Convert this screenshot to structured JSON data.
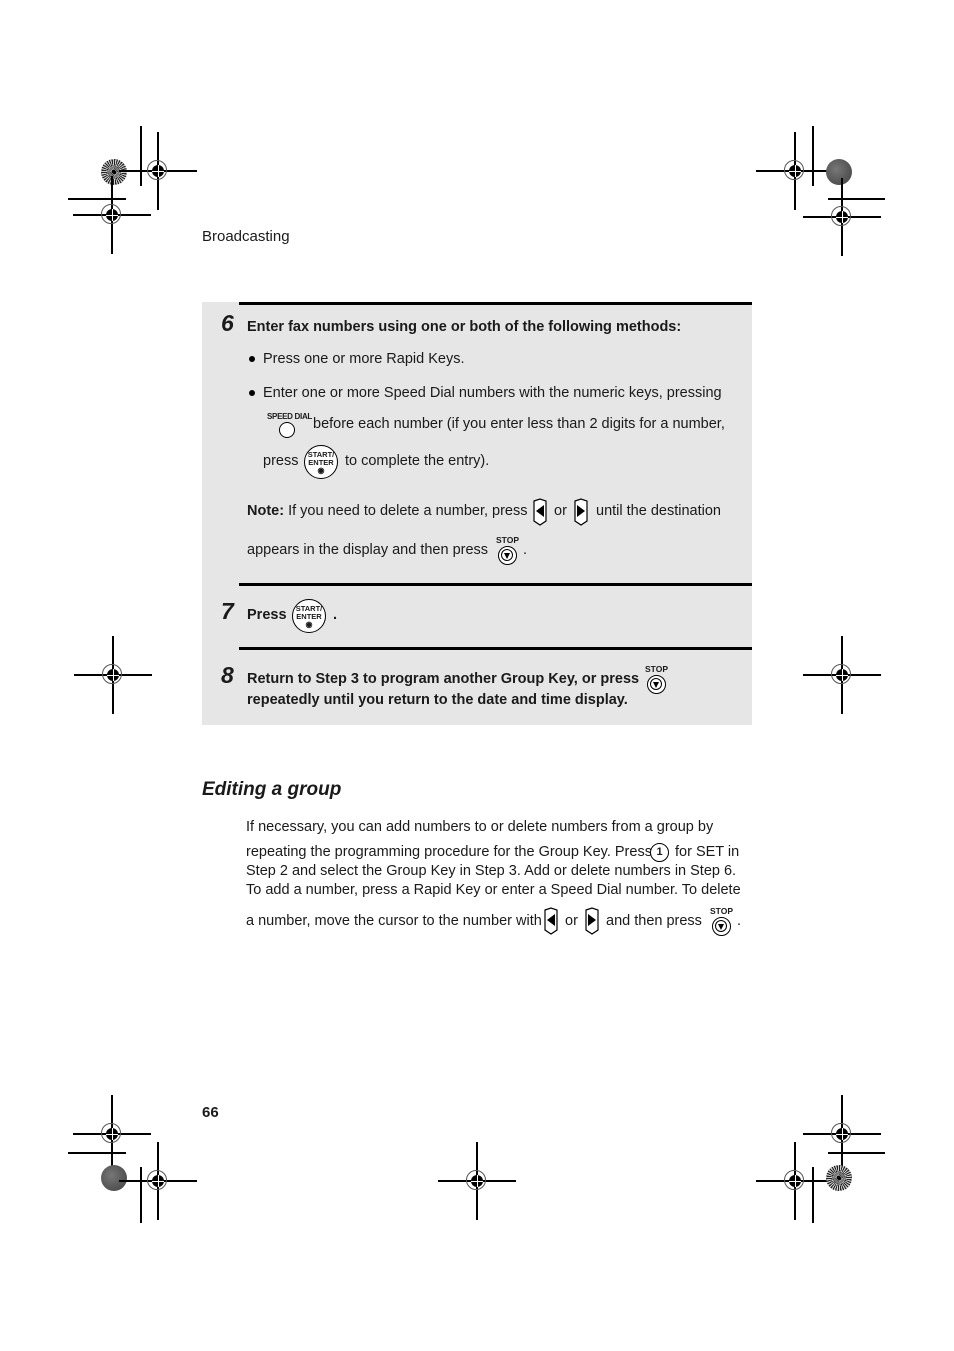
{
  "header": {
    "section": "Broadcasting"
  },
  "footer": {
    "page_number": "66"
  },
  "steps": [
    {
      "number": "6",
      "title": "Enter fax numbers using one or both of the following methods:",
      "bullets": [
        {
          "text": "Press one or more Rapid Keys."
        },
        {
          "line1": "Enter one or more Speed Dial numbers with the numeric keys, pressing",
          "line2": "before each number (if you enter less than 2 digits for a number,",
          "line3_pre": "press",
          "line3_post": "to complete the entry)."
        }
      ],
      "note": {
        "label": "Note:",
        "line1_pre": "If you need to delete a number, press",
        "or": "or",
        "line1_post": "until the destination",
        "line2_pre": "appears in the display and then press",
        "line2_post": "."
      }
    },
    {
      "number": "7",
      "text_pre": "Press",
      "text_post": "."
    },
    {
      "number": "8",
      "line1": "Return to Step 3 to program another Group Key, or press",
      "line2": "repeatedly until you return to the date and time display."
    }
  ],
  "keys": {
    "speed_dial": "SPEED DIAL",
    "start_line1": "START/",
    "start_line2": "ENTER",
    "start_symbol": "◉",
    "stop": "STOP",
    "one": "1"
  },
  "editing": {
    "title": "Editing a group",
    "line1": "If necessary, you can add numbers to or delete numbers from a group by",
    "line2_pre": "repeating the programming procedure for the Group Key. Press",
    "line2_post": "for SET in",
    "line3": "Step 2 and select the Group Key in Step 3. Add or delete numbers in Step 6.",
    "line4": "To add a number, press a Rapid Key or enter a Speed Dial number. To delete",
    "line5_pre": "a number, move the cursor to the number with",
    "line5_or": "or",
    "line5_mid": "and then press",
    "line5_post": "."
  },
  "colors": {
    "box_background": "#e6e6e6",
    "rule": "#000000"
  }
}
